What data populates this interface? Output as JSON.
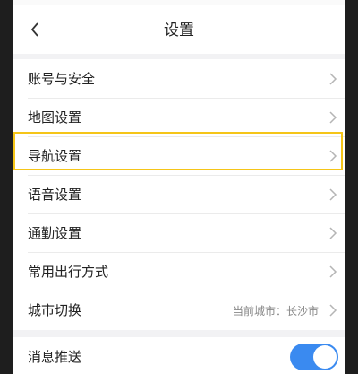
{
  "header": {
    "title": "设置",
    "back_icon": "chevron-left-icon"
  },
  "settings": {
    "items": [
      {
        "label": "账号与安全"
      },
      {
        "label": "地图设置"
      },
      {
        "label": "导航设置"
      },
      {
        "label": "语音设置"
      },
      {
        "label": "通勤设置"
      },
      {
        "label": "常用出行方式"
      },
      {
        "label": "城市切换",
        "value": "当前城市：长沙市"
      }
    ]
  },
  "notifications": {
    "label": "消息推送",
    "toggle_on": true
  },
  "colors": {
    "highlight": "#f5c518",
    "toggle_on": "#3a8af0"
  }
}
